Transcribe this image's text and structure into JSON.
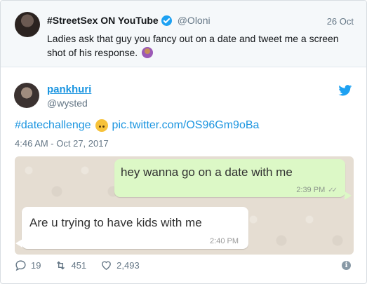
{
  "quoted": {
    "name": "#StreetSex ON YouTube",
    "handle": "@Oloni",
    "date": "26 Oct",
    "text": "Ladies ask that guy you fancy out on a date and tweet me a screen shot of his response.",
    "emoji": "person-shrugging-icon"
  },
  "tweet": {
    "name": "pankhuri",
    "handle": "@wysted",
    "hashtag": "#datechallenge",
    "emoji": "upside-down-face-icon",
    "link": "pic.twitter.com/OS96Gm9oBa",
    "timestamp": "4:46 AM - Oct 27, 2017"
  },
  "chat": {
    "outgoing": {
      "text": "hey wanna go on a date with me",
      "time": "2:39 PM"
    },
    "incoming": {
      "text": "Are u trying to have kids with me",
      "time": "2:40 PM"
    }
  },
  "actions": {
    "replies": "19",
    "retweets": "451",
    "likes": "2,493"
  },
  "colors": {
    "link": "#1b95e0",
    "outgoing_bubble": "#dcf8c6",
    "chat_background": "#e5ddd2"
  }
}
